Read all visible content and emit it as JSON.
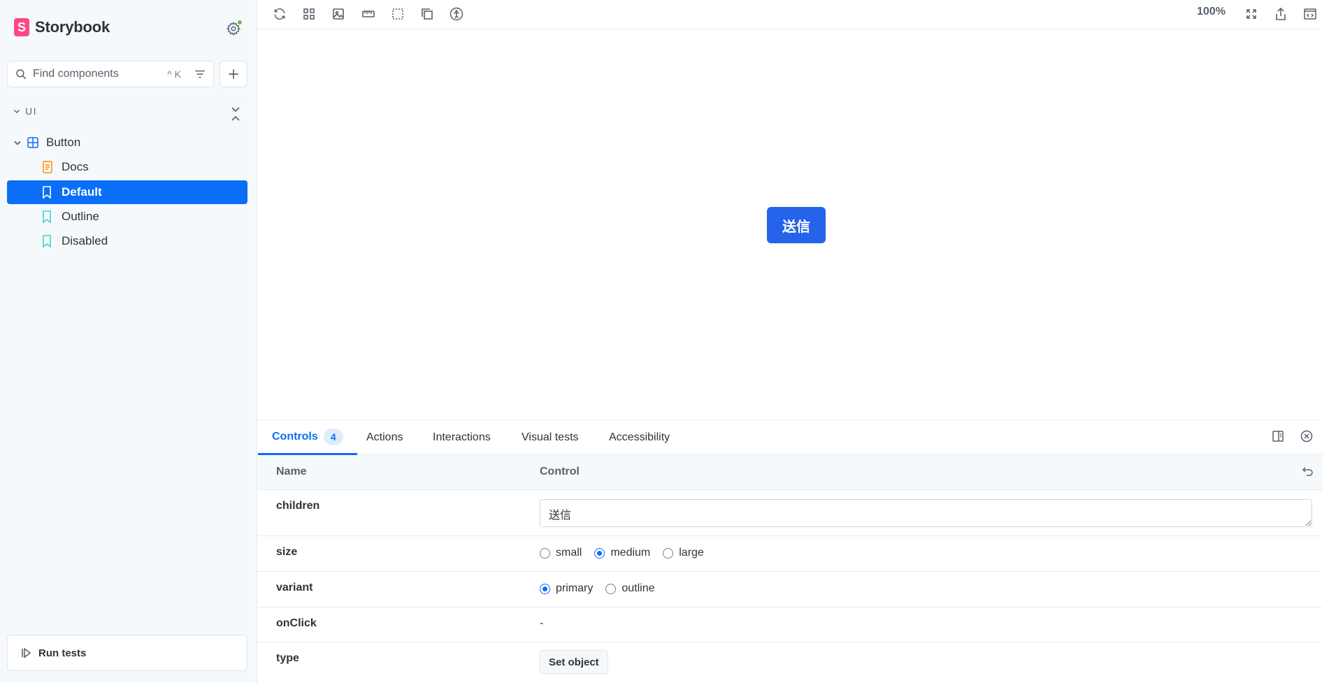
{
  "sidebar": {
    "brand": "Storybook",
    "search": {
      "placeholder": "Find components",
      "shortcut": "^ K"
    },
    "section": "UI",
    "component": "Button",
    "stories": [
      "Docs",
      "Default",
      "Outline",
      "Disabled"
    ],
    "selected_story": "Default",
    "run_tests_label": "Run tests"
  },
  "toolbar": {
    "zoom": "100%"
  },
  "canvas": {
    "button_label": "送信",
    "button_color": "#2563eb"
  },
  "panel": {
    "tabs": [
      {
        "label": "Controls",
        "count": "4"
      },
      {
        "label": "Actions"
      },
      {
        "label": "Interactions"
      },
      {
        "label": "Visual tests"
      },
      {
        "label": "Accessibility"
      }
    ],
    "columns": {
      "name": "Name",
      "control": "Control"
    },
    "rows": {
      "children": {
        "name": "children",
        "value": "送信"
      },
      "size": {
        "name": "size",
        "options": [
          "small",
          "medium",
          "large"
        ],
        "selected": "medium"
      },
      "variant": {
        "name": "variant",
        "options": [
          "primary",
          "outline"
        ],
        "selected": "primary"
      },
      "onClick": {
        "name": "onClick",
        "value": "-"
      },
      "type": {
        "name": "type",
        "button": "Set object"
      }
    }
  },
  "colors": {
    "accent": "#0b6ef7",
    "brand": "#ff4785",
    "status_dot": "#66bf3c"
  }
}
